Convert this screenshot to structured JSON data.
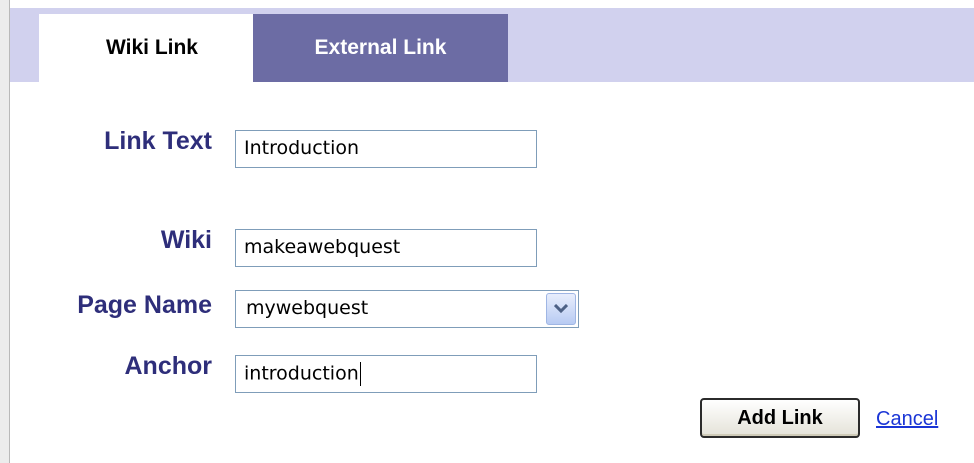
{
  "tabs": {
    "wiki_link": "Wiki Link",
    "external_link": "External Link"
  },
  "form": {
    "link_text": {
      "label": "Link Text",
      "value": "Introduction"
    },
    "wiki": {
      "label": "Wiki",
      "value": "makeawebquest"
    },
    "page_name": {
      "label": "Page Name",
      "value": "mywebquest"
    },
    "anchor": {
      "label": "Anchor",
      "value": "introduction"
    }
  },
  "actions": {
    "add_link": "Add Link",
    "cancel": "Cancel"
  },
  "colors": {
    "tabbar": "#d1d1ee",
    "inactive_tab": "#6c6ca4",
    "label": "#2e2e7a",
    "link": "#1a35d6"
  },
  "icons": {
    "select_arrow": "chevron-down-icon"
  }
}
